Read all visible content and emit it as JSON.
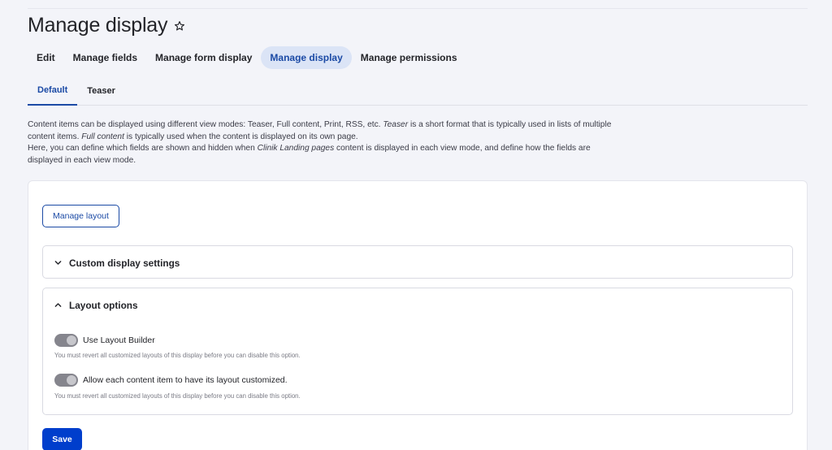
{
  "page": {
    "title": "Manage display"
  },
  "primary_tabs": [
    {
      "label": "Edit",
      "active": false
    },
    {
      "label": "Manage fields",
      "active": false
    },
    {
      "label": "Manage form display",
      "active": false
    },
    {
      "label": "Manage display",
      "active": true
    },
    {
      "label": "Manage permissions",
      "active": false
    }
  ],
  "secondary_tabs": [
    {
      "label": "Default",
      "active": true
    },
    {
      "label": "Teaser",
      "active": false
    }
  ],
  "description": {
    "p1_a": "Content items can be displayed using different view modes: Teaser, Full content, Print, RSS, etc. ",
    "p1_em1": "Teaser",
    "p1_b": " is a short format that is typically used in lists of multiple content items. ",
    "p1_em2": "Full content",
    "p1_c": " is typically used when the content is displayed on its own page.",
    "p2_a": "Here, you can define which fields are shown and hidden when ",
    "p2_em": "Clinik Landing pages",
    "p2_b": " content is displayed in each view mode, and define how the fields are displayed in each view mode."
  },
  "manage_layout_button": "Manage layout",
  "custom_display": {
    "summary": "Custom display settings",
    "expanded": false
  },
  "layout_options": {
    "summary": "Layout options",
    "expanded": true,
    "use_layout_builder": {
      "label": "Use Layout Builder",
      "checked": true,
      "disabled": true,
      "help": "You must revert all customized layouts of this display before you can disable this option."
    },
    "allow_custom": {
      "label": "Allow each content item to have its layout customized.",
      "checked": true,
      "disabled": true,
      "help": "You must revert all customized layouts of this display before you can disable this option."
    }
  },
  "save_button": "Save",
  "colors": {
    "accent": "#003ecc",
    "link_blue": "#1b4aa5",
    "active_tab_bg": "#dbe4f6",
    "page_bg": "#f3f4f9",
    "toggle_track": "#85858d"
  },
  "icons": {
    "title_icon": "star-outline-icon",
    "collapsed_chevron": "chevron-down-icon",
    "expanded_chevron": "chevron-up-icon"
  }
}
